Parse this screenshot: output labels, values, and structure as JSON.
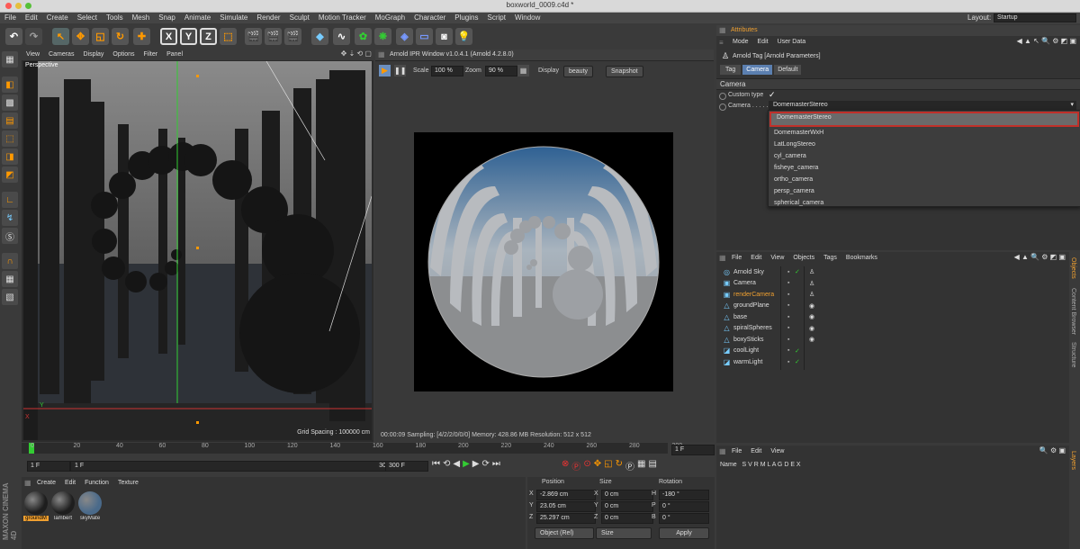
{
  "window": {
    "title": "boxworld_0009.c4d *"
  },
  "menubar": {
    "items": [
      "File",
      "Edit",
      "Create",
      "Select",
      "Tools",
      "Mesh",
      "Snap",
      "Animate",
      "Simulate",
      "Render",
      "Sculpt",
      "Motion Tracker",
      "MoGraph",
      "Character",
      "Plugins",
      "Script",
      "Window"
    ],
    "layout_label": "Layout:",
    "layout_value": "Startup"
  },
  "viewport": {
    "menu": [
      "View",
      "Cameras",
      "Display",
      "Options",
      "Filter",
      "Panel"
    ],
    "label": "Perspective",
    "grid_spacing": "Grid Spacing : 100000 cm",
    "axis_y": "Y",
    "axis_x": "X"
  },
  "ipr": {
    "title": "Arnold IPR Window v1.0.4.1 (Arnold 4.2.8.0)",
    "scale_label": "Scale",
    "scale_value": "100 %",
    "zoom_label": "Zoom",
    "zoom_value": "90 %",
    "display_label": "Display",
    "display_value": "beauty",
    "snapshot": "Snapshot",
    "status": "00:00:09  Sampling: [4/2/2/0/0/0]  Memory: 428.86 MB  Resolution: 512 x 512"
  },
  "attributes": {
    "title": "Attributes",
    "menu": [
      "Mode",
      "Edit",
      "User Data"
    ],
    "header": "Arnold Tag [Arnold Parameters]",
    "tabs": [
      "Tag",
      "Camera",
      "Default"
    ],
    "section": "Camera",
    "custom_type_label": "Custom type",
    "custom_type_check": "✓",
    "camera_label": "Camera . . . . . .",
    "camera_value": "DomemasterStereo",
    "options": [
      "DomemasterStereo",
      "DomemasterWxH",
      "LatLongStereo",
      "cyl_camera",
      "fisheye_camera",
      "ortho_camera",
      "persp_camera",
      "spherical_camera"
    ]
  },
  "objects": {
    "menu": [
      "File",
      "Edit",
      "View",
      "Objects",
      "Tags",
      "Bookmarks"
    ],
    "items": [
      {
        "name": "Arnold Sky",
        "icon": "◎",
        "check": "✓",
        "active": false
      },
      {
        "name": "Camera",
        "icon": "▣",
        "check": "",
        "active": false
      },
      {
        "name": "renderCamera",
        "icon": "▣",
        "check": "",
        "active": true
      },
      {
        "name": "groundPlane",
        "icon": "△",
        "check": "",
        "active": false
      },
      {
        "name": "base",
        "icon": "△",
        "check": "",
        "active": false
      },
      {
        "name": "spiralSpheres",
        "icon": "△",
        "check": "",
        "active": false
      },
      {
        "name": "boxySticks",
        "icon": "△",
        "check": "",
        "active": false
      },
      {
        "name": "coolLight",
        "icon": "◪",
        "check": "✓",
        "active": false
      },
      {
        "name": "warmLight",
        "icon": "◪",
        "check": "✓",
        "active": false
      }
    ],
    "side_tabs": [
      "Objects",
      "Content Browser",
      "Structure"
    ]
  },
  "layers": {
    "menu": [
      "File",
      "Edit",
      "View"
    ],
    "columns": "Name   S V R M L A G D E X",
    "side_tab": "Layers"
  },
  "timeline": {
    "ticks": [
      "0",
      "20",
      "40",
      "60",
      "80",
      "100",
      "120",
      "140",
      "160",
      "180",
      "200",
      "220",
      "240",
      "260",
      "280",
      "300"
    ],
    "frame_field": "1 F"
  },
  "transport": {
    "start": "1 F",
    "current": "1 F",
    "end": "300 F",
    "end2": "300 F"
  },
  "materials": {
    "menu": [
      "Create",
      "Edit",
      "Function",
      "Texture"
    ],
    "items": [
      "groundM",
      "lambert",
      "skyMate"
    ],
    "logo": "MAXON CINEMA 4D"
  },
  "coords": {
    "headers": [
      "Position",
      "Size",
      "Rotation"
    ],
    "rows": [
      {
        "axis": "X",
        "pos": "-2.869 cm",
        "size": "0 cm",
        "rlabel": "H",
        "rot": "-180 °"
      },
      {
        "axis": "Y",
        "pos": "23.05 cm",
        "size": "0 cm",
        "rlabel": "P",
        "rot": "0 °"
      },
      {
        "axis": "Z",
        "pos": "25.297 cm",
        "size": "0 cm",
        "rlabel": "B",
        "rot": "0 °"
      }
    ],
    "mode": "Object (Rel)",
    "size_mode": "Size",
    "apply": "Apply"
  },
  "colors": {
    "accent": "#e0a030",
    "selected_tab": "#5b7fb0",
    "highlight_border": "#c0302a"
  }
}
